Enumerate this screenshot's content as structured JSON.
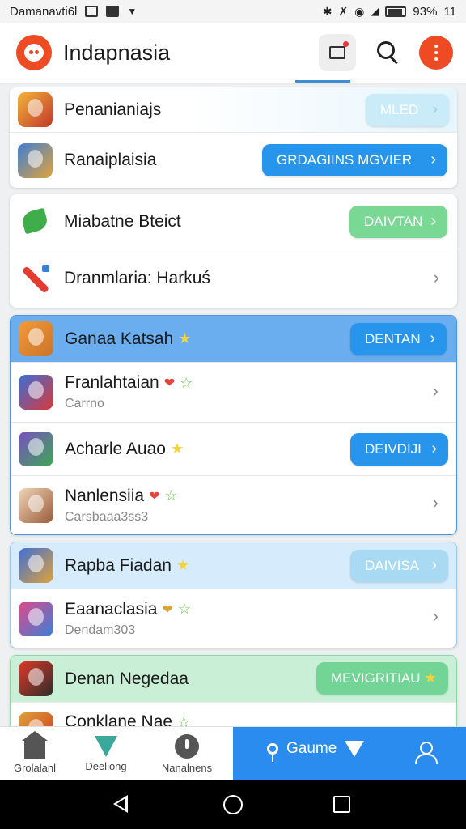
{
  "status_bar": {
    "carrier_text": "Damanavti6l",
    "battery_percent": "93%",
    "time": "11"
  },
  "app_bar": {
    "title": "Indapnasia",
    "icons": [
      "media-icon",
      "search-icon",
      "more-icon"
    ]
  },
  "cards": [
    {
      "rows": [
        {
          "title": "Penanianiajs",
          "button": "MLED",
          "icon_colors": [
            "#f2b53a",
            "#c2372b"
          ]
        },
        {
          "title": "Ranaiplaisia",
          "button": "GRDAGIINS MGVIER",
          "icon_colors": [
            "#3e7fd6",
            "#e0a23a"
          ]
        }
      ]
    },
    {
      "rows": [
        {
          "title": "Miabatne Bteict",
          "button": "DAIVTAN",
          "icon_colors": [
            "#ffffff",
            "#2f9e3a"
          ]
        },
        {
          "title": "Dranmlaria: Harkuś",
          "icon_colors": [
            "#ffffff",
            "#e23b2f"
          ]
        }
      ]
    },
    {
      "rows": [
        {
          "title": "Ganaa Katsah",
          "button": "DENTAN",
          "icon_colors": [
            "#f39a3a",
            "#c9742a"
          ]
        },
        {
          "title": "Franlahtaian",
          "subtitle": "Carrno",
          "icon_colors": [
            "#3a6fd6",
            "#d9383a"
          ]
        },
        {
          "title": "Acharle Auao",
          "button": "DEIVDIJI",
          "icon_colors": [
            "#7a4fc2",
            "#3ea854"
          ]
        },
        {
          "title": "Nanlensiia",
          "subtitle": "Carsbaaa3ss3",
          "icon_colors": [
            "#f0d6b8",
            "#9a5a3a"
          ]
        }
      ]
    },
    {
      "rows": [
        {
          "title": "Rapba Fiadan",
          "button": "DAIVISA",
          "icon_colors": [
            "#3e6fd6",
            "#e0a23a"
          ]
        },
        {
          "title": "Eaanaclasia",
          "subtitle": "Dendam303",
          "icon_colors": [
            "#e04a8a",
            "#3a7fd6"
          ]
        }
      ]
    },
    {
      "rows": [
        {
          "title": "Denan Negedaa",
          "button": "MEVIGRITIAU",
          "icon_colors": [
            "#e03a2a",
            "#2b2b2b"
          ]
        },
        {
          "title": "Conklane Nae",
          "icon_colors": [
            "#e0a23a",
            "#c9371f"
          ]
        }
      ]
    }
  ],
  "bottom_nav": {
    "items": [
      {
        "label": "Grolalanl",
        "icon": "home-icon"
      },
      {
        "label": "Deeliong",
        "icon": "gem-icon"
      },
      {
        "label": "Nanalnens",
        "icon": "power-icon"
      }
    ],
    "active_label": "Gaume",
    "profile_icon": "user-icon"
  },
  "colors": {
    "accent_orange": "#ee4a24",
    "primary_blue": "#2795ec",
    "green": "#79d894",
    "active_nav": "#2b8cf0"
  }
}
